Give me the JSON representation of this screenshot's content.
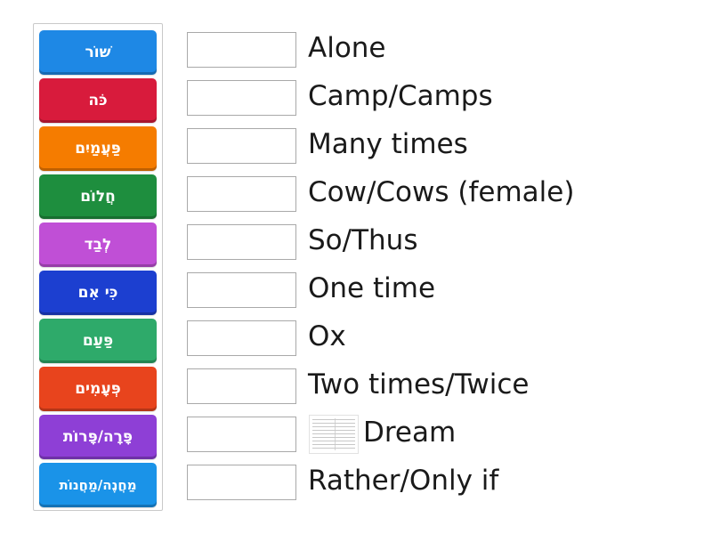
{
  "tiles": [
    {
      "label": "שׁוֹר",
      "color": "#1e88e5"
    },
    {
      "label": "כֹּה",
      "color": "#d81b3c"
    },
    {
      "label": "פַּעֲמַיִם",
      "color": "#f57c00"
    },
    {
      "label": "חֲלוֹם",
      "color": "#1e8e3e"
    },
    {
      "label": "לְבַד",
      "color": "#c04fd6"
    },
    {
      "label": "כִּי אִם",
      "color": "#1c3fd0"
    },
    {
      "label": "פַּעַם",
      "color": "#2eaa6a"
    },
    {
      "label": "פְּעָמִים",
      "color": "#e8441d"
    },
    {
      "label": "פָּרָה/פָּרוֹת",
      "color": "#8e3fd6"
    },
    {
      "label": "מַחֲנֶה/מַחֲנוֹת",
      "color": "#1a93e8"
    }
  ],
  "targets": [
    {
      "label": "Alone"
    },
    {
      "label": "Camp/Camps"
    },
    {
      "label": "Many times"
    },
    {
      "label": "Cow/Cows (female)"
    },
    {
      "label": "So/Thus"
    },
    {
      "label": "One time"
    },
    {
      "label": "Ox"
    },
    {
      "label": "Two times/Twice"
    },
    {
      "label": "Dream",
      "has_image": true
    },
    {
      "label": "Rather/Only if"
    }
  ]
}
